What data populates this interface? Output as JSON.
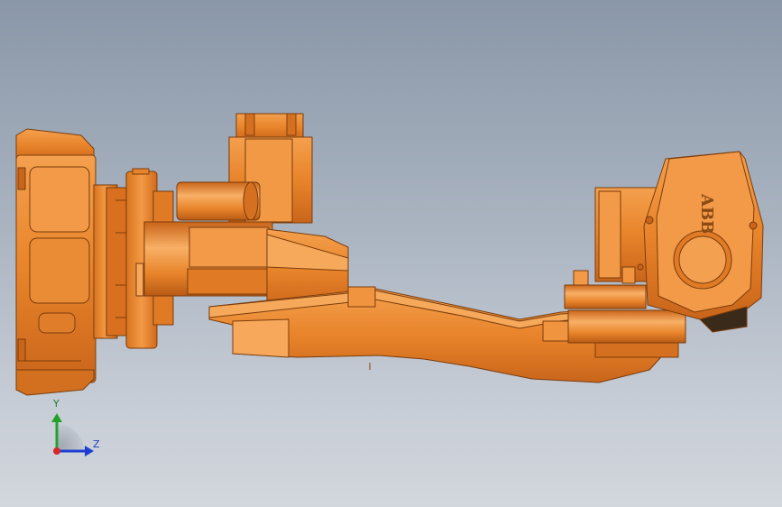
{
  "viewport": {
    "background_top": "#8a97a8",
    "background_bottom": "#d2d6dd"
  },
  "model": {
    "brand_text": "ABB",
    "body_color": "#e8842a",
    "shade_color": "#c9651a",
    "highlight_color": "#f6a95a",
    "edge_color": "#7a3c0c"
  },
  "triad": {
    "y_label": "Y",
    "z_label": "Z",
    "y_color": "#22a22a",
    "z_color": "#1d3fd1",
    "x_color": "#d22a2a"
  }
}
